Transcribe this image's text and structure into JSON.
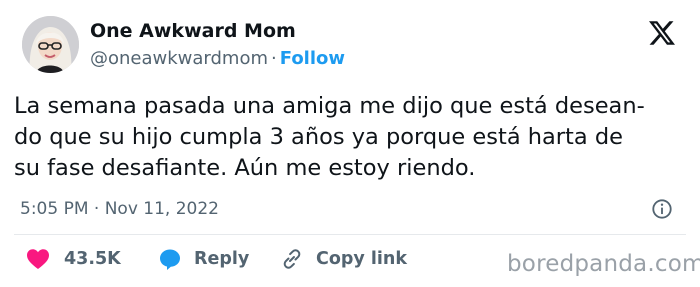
{
  "author": {
    "display_name": "One Awkward Mom",
    "handle": "@oneawkwardmom",
    "separator": "·",
    "follow_label": "Follow"
  },
  "tweet": {
    "lines": [
      "La semana pasada una amiga me dijo que está desean-",
      "do que su hijo cumpla 3 años ya porque está harta de",
      "su fase desafiante. Aún me estoy riendo."
    ],
    "timestamp": "5:05 PM · Nov 11, 2022"
  },
  "actions": {
    "like_count": "43.5K",
    "reply_label": "Reply",
    "copy_link_label": "Copy link"
  },
  "watermark": "boredpanda.com",
  "colors": {
    "text": "#0f1419",
    "secondary": "#536471",
    "accent_blue": "#1d9bf0",
    "like_pink": "#f91880"
  },
  "icons": [
    "avatar",
    "x-logo-icon",
    "info-icon",
    "heart-icon",
    "reply-bubble-icon",
    "link-icon"
  ]
}
